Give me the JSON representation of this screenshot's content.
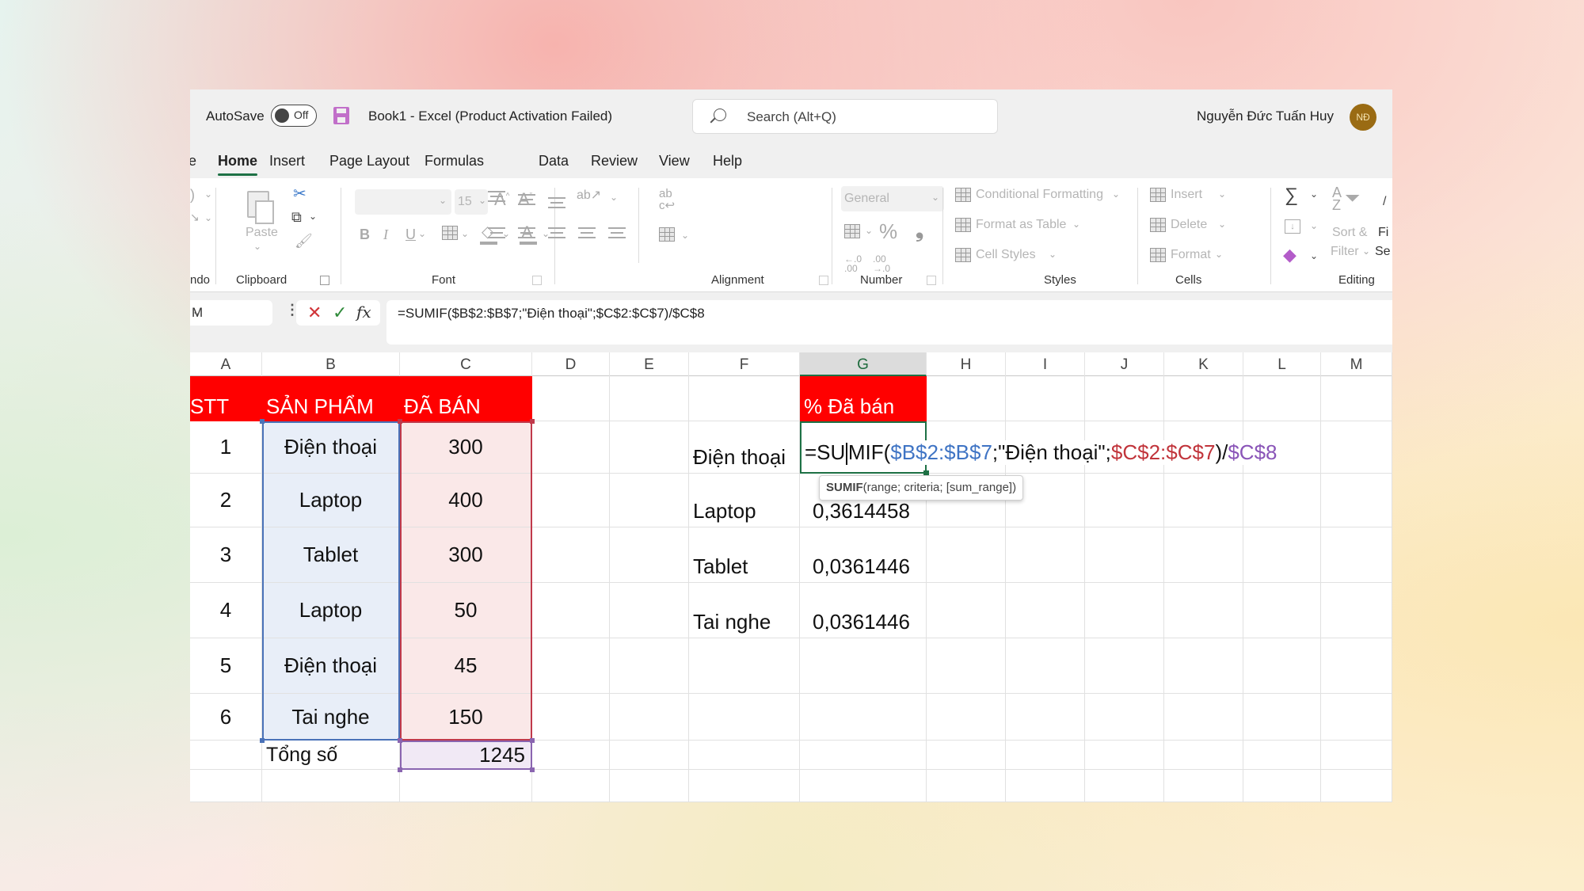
{
  "titlebar": {
    "autosave_label": "AutoSave",
    "autosave_state": "Off",
    "document_title": "Book1  -  Excel (Product Activation Failed)",
    "search_placeholder": "Search (Alt+Q)",
    "user_name": "Nguyễn Đức Tuấn Huy",
    "user_initials": "NĐ"
  },
  "tabs": [
    {
      "label": "e"
    },
    {
      "label": "Home",
      "active": true
    },
    {
      "label": "Insert"
    },
    {
      "label": "Page Layout"
    },
    {
      "label": "Formulas"
    },
    {
      "label": "Data"
    },
    {
      "label": "Review"
    },
    {
      "label": "View"
    },
    {
      "label": "Help"
    }
  ],
  "ribbon": {
    "undo_group": "ndo",
    "clipboard": {
      "label": "Clipboard",
      "paste": "Paste"
    },
    "font": {
      "label": "Font",
      "font_name": "",
      "font_size": "15",
      "bold": "B",
      "italic": "I",
      "underline": "U",
      "grow": "A^",
      "shrink": "Aˇ"
    },
    "alignment": {
      "label": "Alignment"
    },
    "number": {
      "label": "Number",
      "format": "General",
      "percent": "%",
      "comma": "9"
    },
    "styles": {
      "label": "Styles",
      "conditional_formatting": "Conditional Formatting",
      "format_as_table": "Format as Table",
      "cell_styles": "Cell Styles"
    },
    "cells": {
      "label": "Cells",
      "insert": "Insert",
      "delete": "Delete",
      "format": "Format"
    },
    "editing": {
      "label": "Editing",
      "sort_filter_1": "Sort &",
      "sort_filter_2": "Filter",
      "find_1": "Fi",
      "find_2": "Se"
    }
  },
  "formula_bar": {
    "name_box": "M",
    "formula": "=SUMIF($B$2:$B$7;\"Điện thoại\";$C$2:$C$7)/$C$8"
  },
  "columns": [
    "A",
    "B",
    "C",
    "D",
    "E",
    "F",
    "G",
    "H",
    "I",
    "J",
    "K",
    "L",
    "M"
  ],
  "selected_column": "G",
  "table": {
    "headers": {
      "stt": "STT",
      "product": "SẢN PHẨM",
      "sold": "ĐÃ BÁN"
    },
    "rows": [
      {
        "stt": "1",
        "product": "Điện thoại",
        "sold": "300"
      },
      {
        "stt": "2",
        "product": "Laptop",
        "sold": "400"
      },
      {
        "stt": "3",
        "product": "Tablet",
        "sold": "300"
      },
      {
        "stt": "4",
        "product": "Laptop",
        "sold": "50"
      },
      {
        "stt": "5",
        "product": "Điện thoại",
        "sold": "45"
      },
      {
        "stt": "6",
        "product": "Tai nghe",
        "sold": "150"
      }
    ],
    "total_label": "Tổng số",
    "total_value": "1245"
  },
  "percent_table": {
    "header": "% Đã bán",
    "rows": [
      {
        "label": "Điện thoại",
        "value": ""
      },
      {
        "label": "Laptop",
        "value": "0,3614458"
      },
      {
        "label": "Tablet",
        "value": "0,0361446"
      },
      {
        "label": "Tai nghe",
        "value": "0,0361446"
      }
    ]
  },
  "editing_cell": {
    "prefix": "=SU",
    "after_caret": "MIF(",
    "ref1": "$B$2:$B$7",
    "criteria": ";\"Điện thoại\";",
    "ref2": "$C$2:$C$7",
    "close": ")/",
    "ref3": "$C$8"
  },
  "tooltip": {
    "function": "SUMIF",
    "args": "(range; criteria; [sum_range])"
  },
  "colors": {
    "header_red": "#ff0000",
    "accent_green": "#1e7145",
    "ref_blue": "#3f74c4",
    "ref_red": "#c1343b",
    "ref_purple": "#8a55b8"
  }
}
